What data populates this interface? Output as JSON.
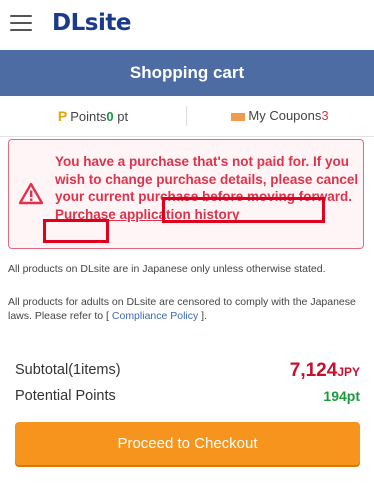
{
  "app": {
    "logo": "DLsite",
    "hamburger_icon": "hamburger-icon"
  },
  "header": {
    "title": "Shopping cart"
  },
  "points": {
    "icon_letter": "P",
    "label": "Points",
    "value": "0",
    "unit": " pt"
  },
  "coupons": {
    "icon": "coupon-icon",
    "label": "My Coupons",
    "value": "3"
  },
  "alert": {
    "icon": "warning-icon",
    "text": "You have a purchase that's not paid for. If you wish to change purchase details, please cancel your current purchase before moving forward.",
    "link_label": "Purchase application history"
  },
  "notices": {
    "japanese_only": "All products on DLsite are in Japanese only unless otherwise stated.",
    "censored_text": "All products for adults on DLsite are censored to comply with the Japanese laws. Please refer to [ ",
    "compliance_link": "Compliance Policy",
    "censored_tail": " ]."
  },
  "summary": {
    "subtotal_label": "Subtotal(1items)",
    "subtotal_value": "7,124",
    "currency": "JPY",
    "points_label": "Potential Points",
    "points_value": "194pt"
  },
  "checkout": {
    "label": "Proceed to Checkout"
  },
  "colors": {
    "header": "#4d6ca3",
    "checkout": "#f7941d",
    "alert": "#e0324a",
    "points": "#1a9a3b"
  }
}
